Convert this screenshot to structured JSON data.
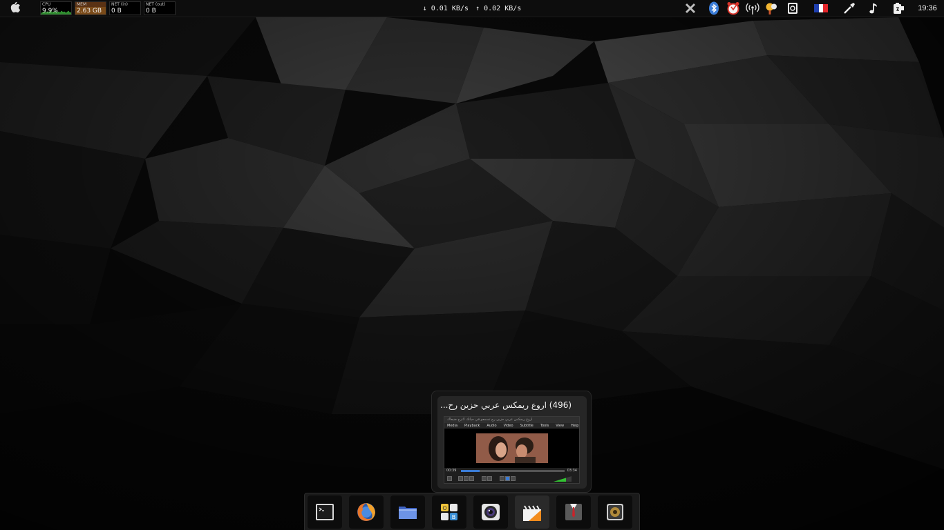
{
  "topbar": {
    "monitors": {
      "cpu": {
        "label": "CPU",
        "value": "9.9%"
      },
      "mem": {
        "label": "MEM",
        "value": "2.63 GB"
      },
      "net_in": {
        "label": "NET (in)",
        "value": "0 B"
      },
      "net_out": {
        "label": "NET (out)",
        "value": "0 B"
      }
    },
    "netspeed": {
      "down": "↓ 0.01 KB/s",
      "up": "↑ 0.02 KB/s"
    },
    "tray_icons": [
      "close-x-icon",
      "bluetooth-icon",
      "alarm-clock-icon",
      "wireless-icon",
      "weather-icon",
      "screenshot-icon",
      "france-flag-icon",
      "color-picker-icon",
      "music-note-icon",
      "battery-icon"
    ],
    "clock": "19:36"
  },
  "window_preview": {
    "title": "(496) اروع ريمكس عربي حزين رح...",
    "thumbnail": {
      "window_title": "اروع ريمكس عربي حزين رح تسمعو في حياتك لاترح ضيعاك",
      "menu": [
        "Media",
        "Playback",
        "Audio",
        "Video",
        "Subtitle",
        "Tools",
        "View",
        "Help"
      ],
      "elapsed": "00:39",
      "duration": "03:34",
      "progress": 0.18
    }
  },
  "dock": {
    "items": [
      {
        "name": "terminal",
        "icon": "terminal-icon",
        "active": false
      },
      {
        "name": "firefox",
        "icon": "firefox-icon",
        "active": false
      },
      {
        "name": "files",
        "icon": "folder-icon",
        "active": false
      },
      {
        "name": "office",
        "icon": "office-icon",
        "active": false
      },
      {
        "name": "camera",
        "icon": "camera-icon",
        "active": false
      },
      {
        "name": "vlc",
        "icon": "clapper-icon",
        "active": true
      },
      {
        "name": "system",
        "icon": "suit-icon",
        "active": false
      },
      {
        "name": "sound",
        "icon": "speaker-icon",
        "active": false
      }
    ]
  },
  "colors": {
    "panel": "#0d0d0d",
    "accent_blue": "#3a7bd5",
    "mem_fill": "#7a4a18"
  }
}
